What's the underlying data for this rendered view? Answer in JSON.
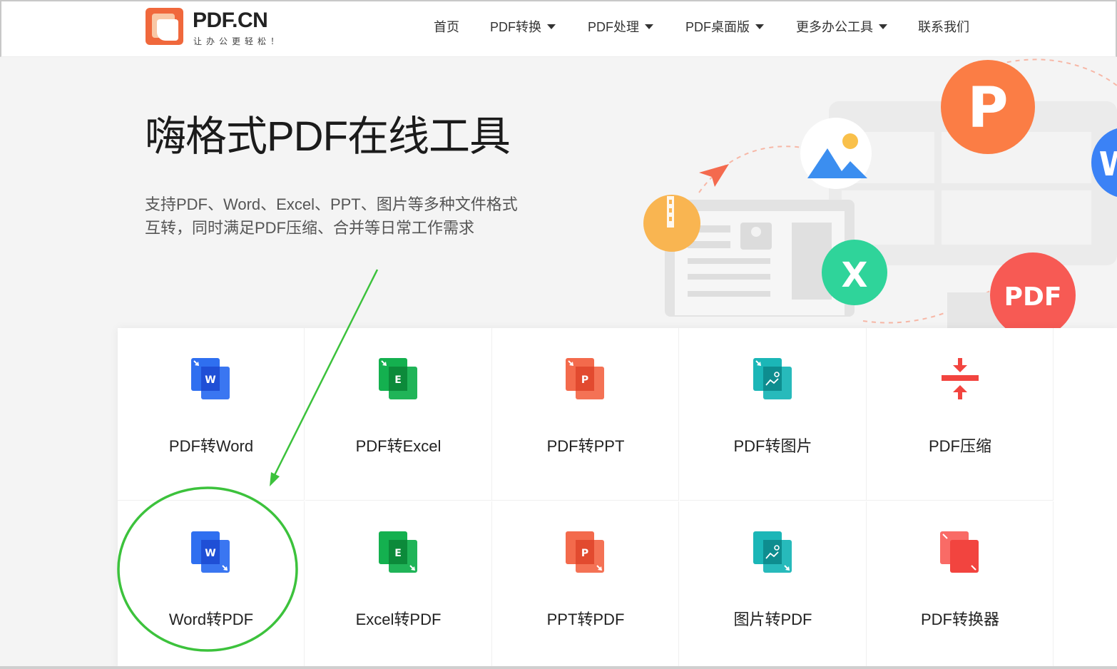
{
  "header": {
    "logo_title": "PDF.CN",
    "logo_slogan": "让办公更轻松！",
    "nav": [
      {
        "label": "首页",
        "dropdown": false
      },
      {
        "label": "PDF转换",
        "dropdown": true
      },
      {
        "label": "PDF处理",
        "dropdown": true
      },
      {
        "label": "PDF桌面版",
        "dropdown": true
      },
      {
        "label": "更多办公工具",
        "dropdown": true
      },
      {
        "label": "联系我们",
        "dropdown": false
      }
    ]
  },
  "hero": {
    "title": "嗨格式PDF在线工具",
    "desc_line1": "支持PDF、Word、Excel、PPT、图片等多种文件格式",
    "desc_line2": "互转，同时满足PDF压缩、合并等日常工作需求",
    "badge_p": "P",
    "badge_x": "X",
    "badge_pdf": "PDF",
    "badge_w": "W"
  },
  "tools": {
    "row1": [
      {
        "label": "PDF转Word",
        "icon": "word-doc-icon",
        "letter": "W",
        "color": "#2f6ff0",
        "dark": "#1f4fd6"
      },
      {
        "label": "PDF转Excel",
        "icon": "excel-doc-icon",
        "letter": "E",
        "color": "#14b04f",
        "dark": "#0c8a3a"
      },
      {
        "label": "PDF转PPT",
        "icon": "ppt-doc-icon",
        "letter": "P",
        "color": "#f36a4c",
        "dark": "#e24a2f"
      },
      {
        "label": "PDF转图片",
        "icon": "image-doc-icon",
        "letter": "",
        "color": "#1bb6b7",
        "dark": "#0e8d8f"
      },
      {
        "label": "PDF压缩",
        "icon": "compress-icon",
        "letter": "",
        "color": "#f2443f",
        "dark": "#d8302c"
      }
    ],
    "row2": [
      {
        "label": "Word转PDF",
        "icon": "word-to-pdf-icon",
        "letter": "W",
        "color": "#2f6ff0",
        "dark": "#1f4fd6"
      },
      {
        "label": "Excel转PDF",
        "icon": "excel-to-pdf-icon",
        "letter": "E",
        "color": "#14b04f",
        "dark": "#0c8a3a"
      },
      {
        "label": "PPT转PDF",
        "icon": "ppt-to-pdf-icon",
        "letter": "P",
        "color": "#f36a4c",
        "dark": "#e24a2f"
      },
      {
        "label": "图片转PDF",
        "icon": "image-to-pdf-icon",
        "letter": "",
        "color": "#1bb6b7",
        "dark": "#0e8d8f"
      },
      {
        "label": "PDF转换器",
        "icon": "pdf-converter-icon",
        "letter": "",
        "color": "#f2443f",
        "dark": "#f96b66"
      }
    ]
  },
  "annotation": {
    "color": "#3cc23c"
  }
}
